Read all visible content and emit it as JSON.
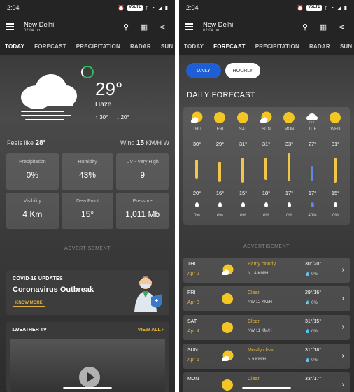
{
  "status": {
    "time": "2:04",
    "vpn": "VoLTE"
  },
  "location": {
    "city": "New Delhi",
    "time": "02:04 pm"
  },
  "tabs": [
    "TODAY",
    "FORECAST",
    "PRECIPITATION",
    "RADAR",
    "SUN & MO"
  ],
  "today": {
    "temp": "29°",
    "condition": "Haze",
    "high": "30°",
    "low": "20°",
    "feels_label": "Feels like",
    "feels_value": "28°",
    "wind_label": "Wind",
    "wind_value": "15",
    "wind_unit": "KM/H W",
    "metrics": [
      {
        "label": "Precipitation",
        "value": "0%"
      },
      {
        "label": "Humidity",
        "value": "43%"
      },
      {
        "label": "UV - Very High",
        "value": "9"
      },
      {
        "label": "Visibility",
        "value": "4 Km"
      },
      {
        "label": "Dew Point",
        "value": "15°"
      },
      {
        "label": "Pressure",
        "value": "1,011 Mb"
      }
    ],
    "ad": "ADVERTISEMENT",
    "covid": {
      "header": "COVID-19 UPDATES",
      "title": "Coronavirus Outbreak",
      "button": "KNOW MORE"
    },
    "tv": {
      "title": "1WEATHER TV",
      "view_all": "VIEW ALL"
    }
  },
  "forecast": {
    "toggle_daily": "DAILY",
    "toggle_hourly": "HOURLY",
    "title": "DAILY FORECAST",
    "days": [
      {
        "day": "THU",
        "hi": "30°",
        "lo": "20°",
        "pct": "0%",
        "icon": "partly-cloudy"
      },
      {
        "day": "FRI",
        "hi": "29°",
        "lo": "16°",
        "pct": "0%",
        "icon": "sun"
      },
      {
        "day": "SAT",
        "hi": "31°",
        "lo": "15°",
        "pct": "0%",
        "icon": "sun"
      },
      {
        "day": "SUN",
        "hi": "31°",
        "lo": "18°",
        "pct": "0%",
        "icon": "partly-cloudy"
      },
      {
        "day": "MON",
        "hi": "33°",
        "lo": "17°",
        "pct": "0%",
        "icon": "sun"
      },
      {
        "day": "TUE",
        "hi": "27°",
        "lo": "17°",
        "pct": "40%",
        "icon": "rain-cloud"
      },
      {
        "day": "WED",
        "hi": "31°",
        "lo": "15°",
        "pct": "0%",
        "icon": "sun"
      }
    ],
    "ad": "ADVERTISEMENT",
    "rows": [
      {
        "day": "THU",
        "date": "Apr 2",
        "cond": "Partly cloudy",
        "wind": "N 14 KM/H",
        "temps": "30°/20°",
        "pct": "0%"
      },
      {
        "day": "FRI",
        "date": "Apr 3",
        "cond": "Clear",
        "wind": "NW 12 KM/H",
        "temps": "29°/16°",
        "pct": "0%"
      },
      {
        "day": "SAT",
        "date": "Apr 4",
        "cond": "Clear",
        "wind": "NW 11 KM/H",
        "temps": "31°/15°",
        "pct": "0%"
      },
      {
        "day": "SUN",
        "date": "Apr 5",
        "cond": "Mostly clear",
        "wind": "N 9 KM/H",
        "temps": "31°/18°",
        "pct": "0%"
      },
      {
        "day": "MON",
        "date": "",
        "cond": "Clear",
        "wind": "",
        "temps": "33°/17°",
        "pct": ""
      }
    ]
  },
  "colors": {
    "accent": "#1e5fd6",
    "gold": "#e3b23c",
    "sun": "#f3c623"
  }
}
